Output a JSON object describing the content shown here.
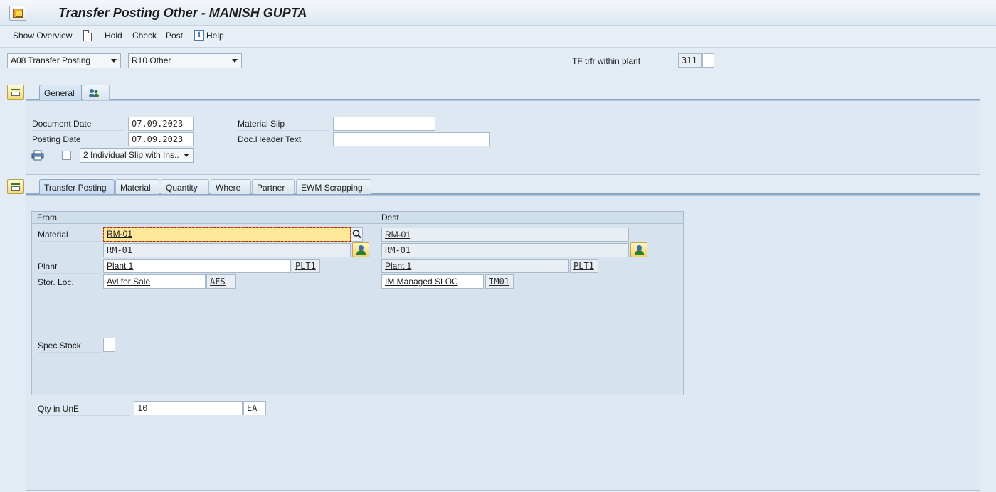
{
  "window": {
    "title": "Transfer Posting Other - MANISH GUPTA"
  },
  "toolbar": {
    "show_overview": "Show Overview",
    "hold": "Hold",
    "check": "Check",
    "post": "Post",
    "help": "Help"
  },
  "header": {
    "transaction_select": "A08 Transfer Posting",
    "reference_select": "R10 Other",
    "movement_label": "TF trfr within plant",
    "movement_type": "311",
    "movement_indicator": ""
  },
  "general_tab": {
    "tab_label": "General",
    "document_date_label": "Document Date",
    "document_date": "07.09.2023",
    "posting_date_label": "Posting Date",
    "posting_date": "07.09.2023",
    "print_version": "2 Individual Slip with Ins..",
    "material_slip_label": "Material Slip",
    "material_slip": "",
    "doc_header_text_label": "Doc.Header Text",
    "doc_header_text": ""
  },
  "detail_tabs": [
    "Transfer Posting",
    "Material",
    "Quantity",
    "Where",
    "Partner",
    "EWM Scrapping"
  ],
  "from": {
    "heading": "From",
    "material_label": "Material",
    "material": "RM-01",
    "material_desc": "RM-01",
    "plant_label": "Plant",
    "plant": "Plant 1",
    "plant_code": "PLT1",
    "sloc_label": "Stor. Loc.",
    "sloc": "Avl for Sale",
    "sloc_code": "AFS",
    "spec_stock_label": "Spec.Stock",
    "spec_stock": ""
  },
  "dest": {
    "heading": "Dest",
    "material": "RM-01",
    "material_desc": "RM-01",
    "plant": "Plant 1",
    "plant_code": "PLT1",
    "sloc": "IM Managed SLOC",
    "sloc_code": "IM01"
  },
  "quantity": {
    "label": "Qty in UnE",
    "value": "10",
    "unit": "EA"
  }
}
